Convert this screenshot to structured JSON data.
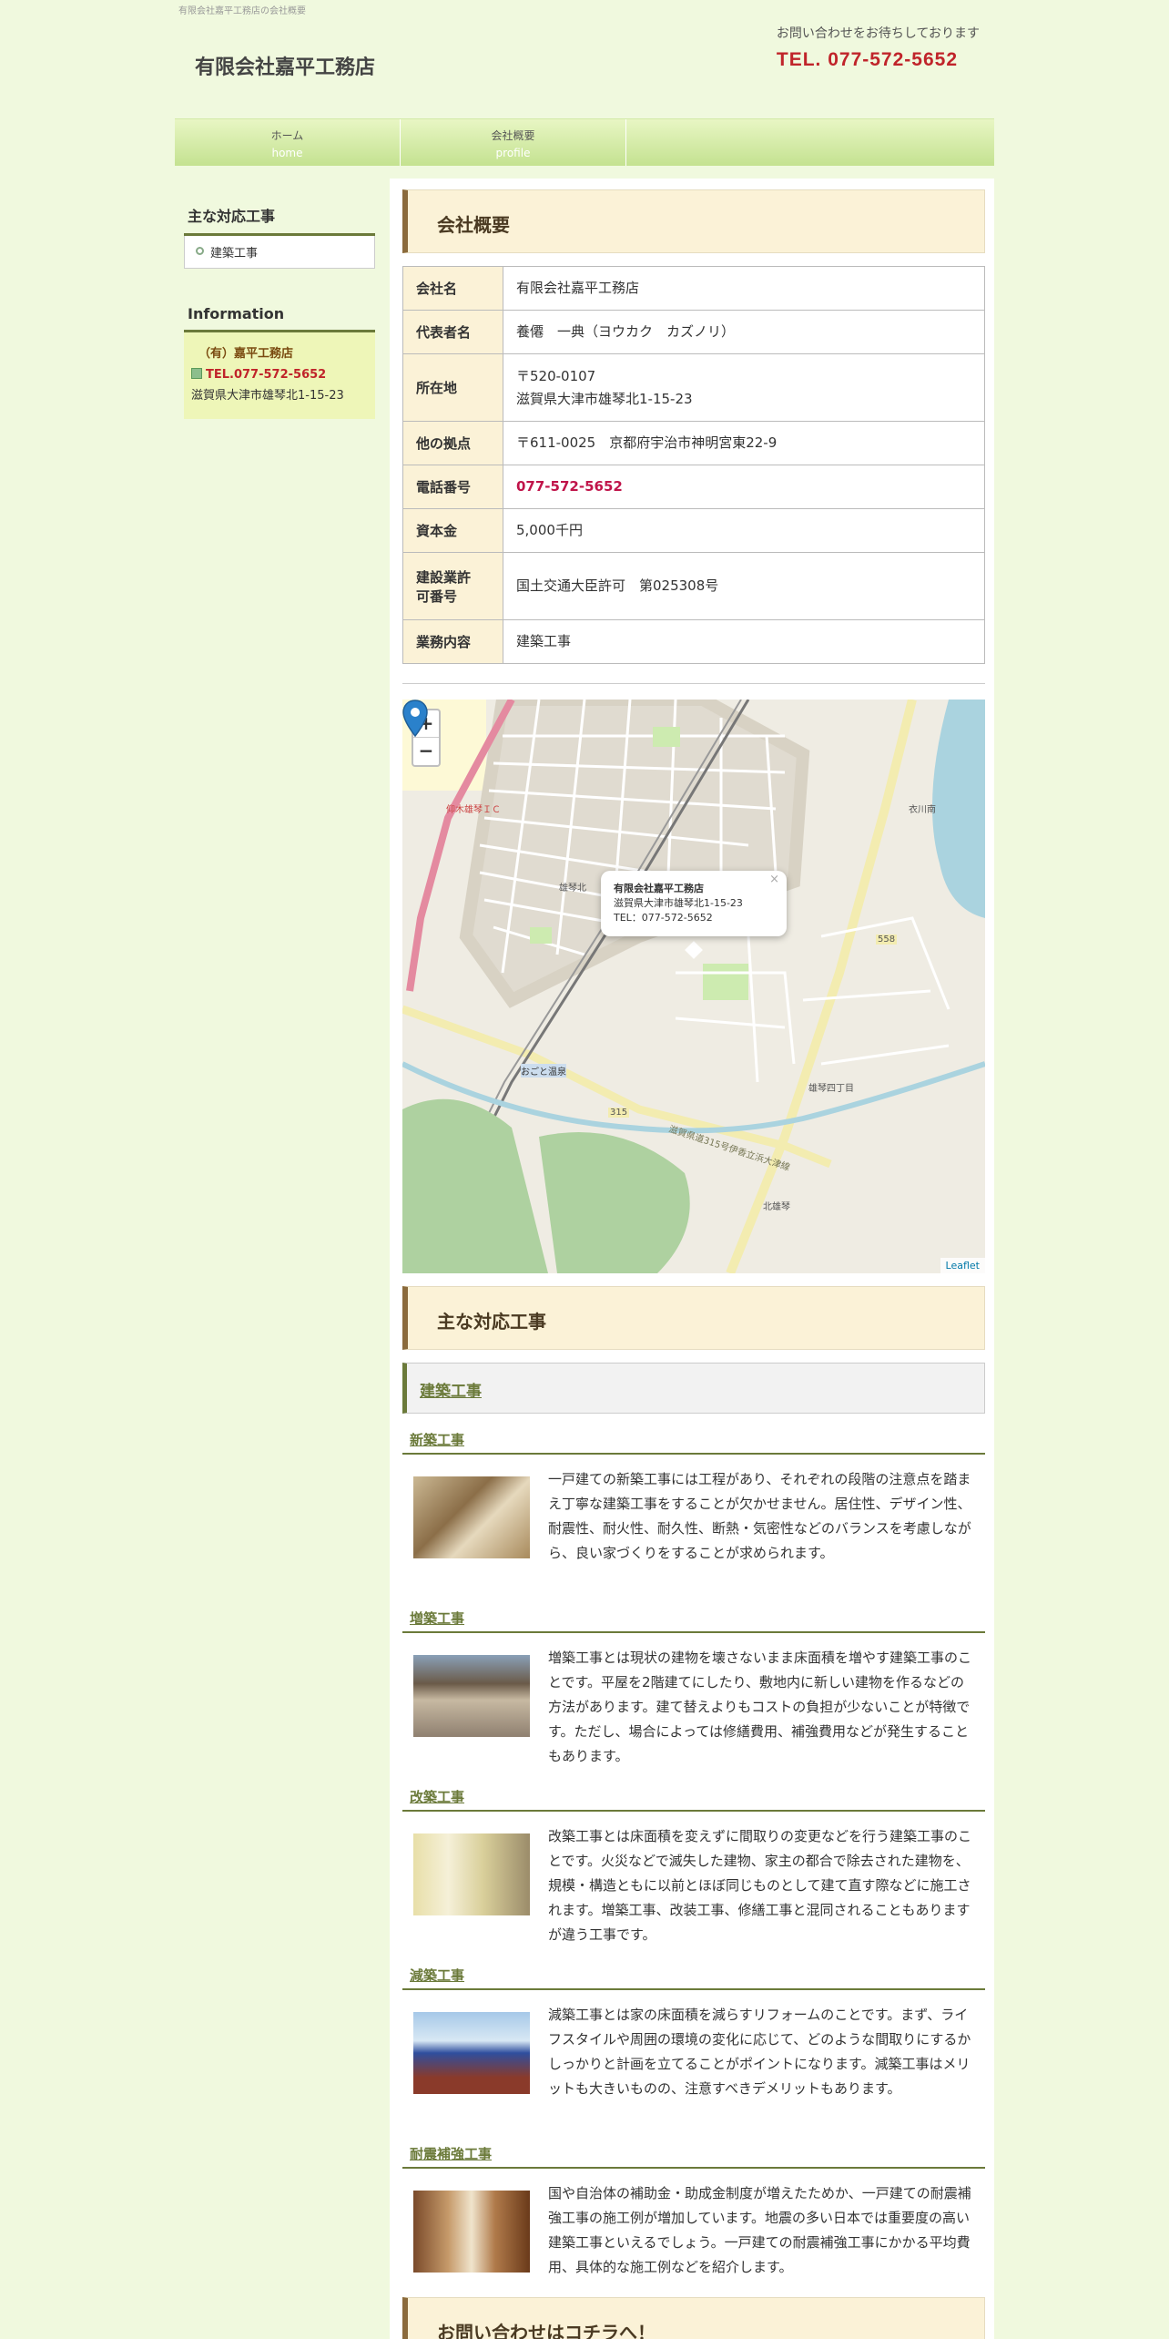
{
  "header": {
    "tagline": "有限会社嘉平工務店の会社概要",
    "site_title": "有限会社嘉平工務店",
    "contact_note": "お問い合わせをお待ちしております",
    "contact_tel": "TEL. 077-572-5652"
  },
  "gnav": [
    {
      "label": "ホーム",
      "sub": "home"
    },
    {
      "label": "会社概要",
      "sub": "profile"
    }
  ],
  "sidebar": {
    "menu_heading": "主な対応工事",
    "menu_items": [
      "建築工事"
    ],
    "info_heading": "Information",
    "info_name": "（有）嘉平工務店",
    "info_tel": "TEL.077-572-5652",
    "info_address": "滋賀県大津市雄琴北1-15-23"
  },
  "main": {
    "company_heading": "会社概要",
    "table": [
      {
        "label": "会社名",
        "value": "有限会社嘉平工務店"
      },
      {
        "label": "代表者名",
        "value": "養僊　一典（ヨウカク　カズノリ）"
      },
      {
        "label": "所在地",
        "value": "〒520-0107",
        "value2": "滋賀県大津市雄琴北1-15-23"
      },
      {
        "label": "他の拠点",
        "value": "〒611-0025　京都府宇治市神明宮東22-9"
      },
      {
        "label": "電話番号",
        "value": "077-572-5652"
      },
      {
        "label": "資本金",
        "value": "5,000千円"
      },
      {
        "label": "建設業許",
        "label2": "可番号",
        "value": "国土交通大臣許可　第025308号"
      },
      {
        "label": "業務内容",
        "value": "建築工事"
      }
    ],
    "map": {
      "zoom_in": "+",
      "zoom_out": "−",
      "popup_title": "有限会社嘉平工務店",
      "popup_address": "滋賀県大津市雄琴北1-15-23",
      "popup_tel": "TEL：077-572-5652",
      "popup_close": "×",
      "attribution": "Leaflet",
      "labels": [
        "仰木雄琴ＩＣ",
        "雄琴北",
        "おごと温泉",
        "雄琴四丁目",
        "北雄琴",
        "衣川南",
        "315",
        "558",
        "滋賀県道315号伊香立浜大津線"
      ]
    },
    "works_heading": "主な対応工事",
    "works_sub": "建築工事",
    "works": [
      {
        "title": "新築工事",
        "text": "一戸建ての新築工事には工程があり、それぞれの段階の注意点を踏まえ丁寧な建築工事をすることが欠かせません。居住性、デザイン性、耐震性、耐火性、耐久性、断熱・気密性などのバランスを考慮しながら、良い家づくりをすることが求められます。"
      },
      {
        "title": "増築工事",
        "text": "増築工事とは現状の建物を壊さないまま床面積を増やす建築工事のことです。平屋を2階建てにしたり、敷地内に新しい建物を作るなどの方法があります。建て替えよりもコストの負担が少ないことが特徴です。ただし、場合によっては修繕費用、補強費用などが発生することもあります。"
      },
      {
        "title": "改築工事",
        "text": "改築工事とは床面積を変えずに間取りの変更などを行う建築工事のことです。火災などで滅失した建物、家主の都合で除去された建物を、規模・構造ともに以前とほぼ同じものとして建て直す際などに施工されます。増築工事、改装工事、修繕工事と混同されることもありますが違う工事です。"
      },
      {
        "title": "減築工事",
        "text": "減築工事とは家の床面積を減らすリフォームのことです。まず、ライフスタイルや周囲の環境の変化に応じて、どのような間取りにするかしっかりと計画を立てることがポイントになります。減築工事はメリットも大きいものの、注意すべきデメリットもあります。"
      },
      {
        "title": "耐震補強工事",
        "text": "国や自治体の補助金・助成金制度が増えたためか、一戸建ての耐震補強工事の施工例が増加しています。地震の多い日本では重要度の高い建築工事といえるでしょう。一戸建ての耐震補強工事にかかる平均費用、具体的な施工例などを紹介します。"
      }
    ],
    "contact_heading": "お問い合わせはコチラへ！"
  }
}
